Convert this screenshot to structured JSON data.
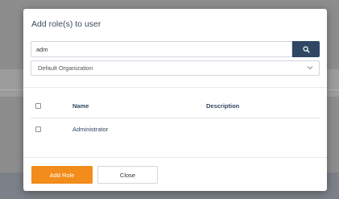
{
  "dialog": {
    "title": "Add role(s) to user",
    "search": {
      "value": "adm",
      "button_icon": "search-icon"
    },
    "organization_select": {
      "selected": "Default Organization",
      "icon": "chevron-down-icon"
    },
    "table": {
      "columns": [
        "Name",
        "Description"
      ],
      "rows": [
        {
          "name": "Administrator",
          "description": ""
        }
      ]
    },
    "buttons": {
      "add_role": "Add Role",
      "close": "Close"
    },
    "colors": {
      "primary_navy": "#2f4763",
      "accent_orange": "#f28c1a"
    }
  }
}
